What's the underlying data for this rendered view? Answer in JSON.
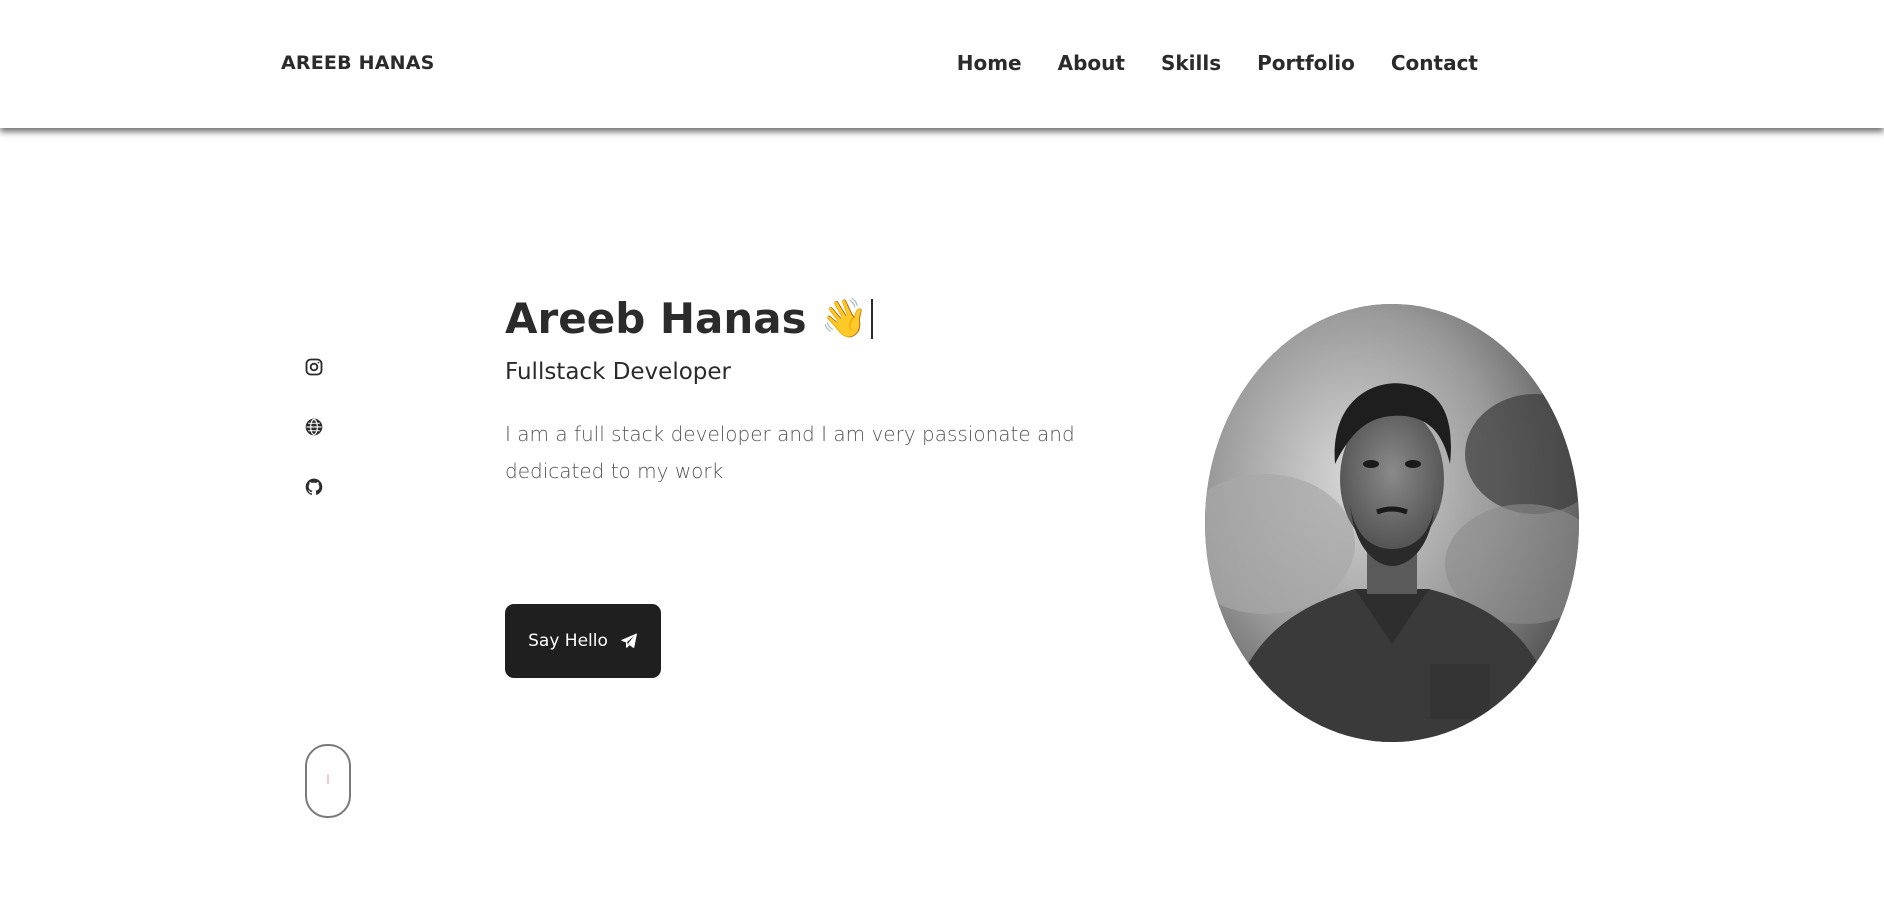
{
  "brand": "AREEB HANAS",
  "nav": {
    "home": "Home",
    "about": "About",
    "skills": "Skills",
    "portfolio": "Portfolio",
    "contact": "Contact"
  },
  "hero": {
    "name": "Areeb Hanas",
    "wave": "👋",
    "subtitle": "Fullstack Developer",
    "description": "I am a full stack developer and I am very passionate and dedicated to my work",
    "cta_label": "Say Hello"
  },
  "socials": {
    "items": [
      {
        "icon": "instagram-icon"
      },
      {
        "icon": "globe-icon"
      },
      {
        "icon": "github-icon"
      }
    ]
  },
  "icons": {
    "cta": "send-icon",
    "scroll": "mouse-scroll-icon"
  },
  "colors": {
    "text": "#2b2b2b",
    "button_bg": "#1f1f1f",
    "button_text": "#ffffff",
    "background": "#ffffff"
  }
}
